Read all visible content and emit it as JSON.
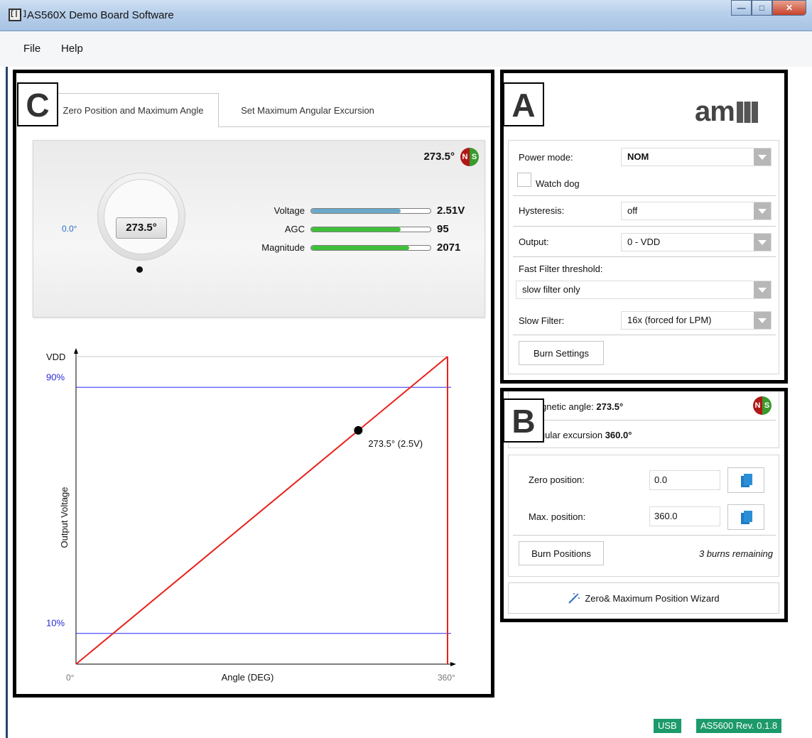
{
  "window": {
    "title": "AS560X Demo Board Software",
    "icon_text": "[||]"
  },
  "menu": {
    "file": "File",
    "help": "Help"
  },
  "annotations": {
    "a": "A",
    "b": "B",
    "c": "C"
  },
  "tabs": [
    {
      "label": "Set Zero Position and Maximum Angle",
      "visible_label": "Zero Position and Maximum Angle",
      "active": true
    },
    {
      "label": "Set Maximum Angular Excursion",
      "active": false
    }
  ],
  "gauge": {
    "angle": "273.5°",
    "readout": "273.5°",
    "zero_label": "0.0°",
    "meters": [
      {
        "label": "Voltage",
        "value": "2.51V",
        "fill": 0.75,
        "color": "#6aa9c9"
      },
      {
        "label": "AGC",
        "value": "95",
        "fill": 0.75,
        "color": "#3fbf3a"
      },
      {
        "label": "Magnitude",
        "value": "2071",
        "fill": 0.82,
        "color": "#3fbf3a"
      }
    ]
  },
  "chart_data": {
    "type": "line",
    "xlabel": "Angle (DEG)",
    "ylabel": "Output Voltage",
    "x_ticks": [
      "0°",
      "360°"
    ],
    "y_ticks": [
      "VDD",
      "90%",
      "10%"
    ],
    "series": [
      {
        "x": [
          0,
          360
        ],
        "y": [
          0,
          100
        ],
        "color": "#e8201a"
      }
    ],
    "reference_lines": [
      {
        "y": 90,
        "color": "#2828ff"
      },
      {
        "y": 10,
        "color": "#2828ff"
      }
    ],
    "vertical_line": {
      "x": 360,
      "color": "#e8201a"
    },
    "marker": {
      "x": 273.5,
      "y": 76,
      "label": "273.5° (2.5V)"
    },
    "xlim": [
      0,
      360
    ],
    "ylim": [
      0,
      100
    ]
  },
  "logo": {
    "text": "am"
  },
  "settings": {
    "power_mode_label": "Power mode:",
    "power_mode_value": "NOM",
    "watchdog_label": "Watch dog",
    "hysteresis_label": "Hysteresis:",
    "hysteresis_value": "off",
    "output_label": "Output:",
    "output_value": "0 - VDD",
    "fast_filter_label": "Fast Filter threshold:",
    "fast_filter_value": "slow filter only",
    "slow_filter_label": "Slow Filter:",
    "slow_filter_value": "16x (forced for LPM)",
    "burn_settings": "Burn Settings"
  },
  "status": {
    "magnetic_angle_label": "Magnetic angle:",
    "magnetic_angle_value": "273.5°",
    "angular_excursion_label": "Angular excursion",
    "angular_excursion_value": "360.0°"
  },
  "positions": {
    "zero_label": "Zero position:",
    "zero_value": "0.0",
    "max_label": "Max. position:",
    "max_value": "360.0",
    "burn_positions": "Burn Positions",
    "burns_remaining": "3 burns remaining"
  },
  "wizard": {
    "label": "Zero& Maximum Position Wizard"
  },
  "statusbar": {
    "usb": "USB",
    "version": "AS5600 Rev. 0.1.8"
  }
}
